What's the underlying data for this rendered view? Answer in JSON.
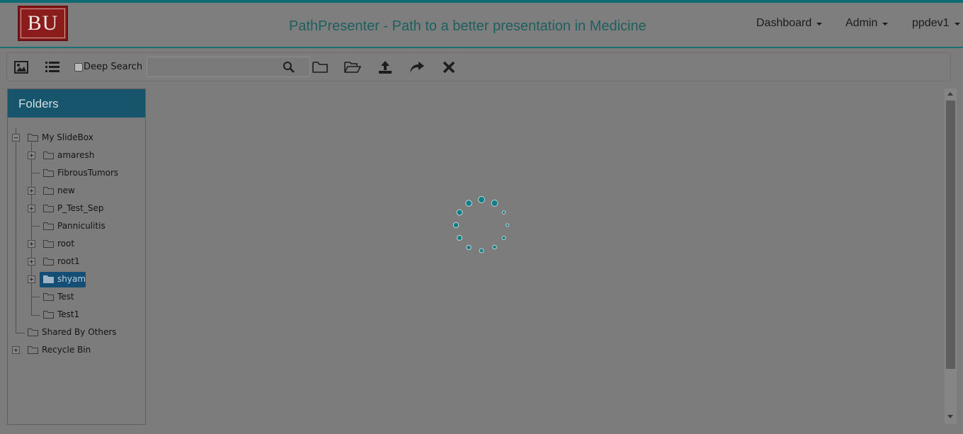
{
  "header": {
    "logo_text": "BU",
    "title": "PathPresenter - Path to a better presentation in Medicine",
    "menus": [
      {
        "label": "Dashboard"
      },
      {
        "label": "Admin"
      },
      {
        "label": "ppdev1"
      }
    ]
  },
  "toolbar": {
    "icons": [
      "image-view-icon",
      "list-view-icon",
      "search-icon",
      "new-folder-icon",
      "open-folder-icon",
      "upload-icon",
      "share-icon",
      "delete-icon"
    ],
    "deep_search_label": "Deep Search",
    "deep_search_checked": false,
    "search_value": "",
    "search_placeholder": ""
  },
  "folders_panel": {
    "title": "Folders",
    "tree": [
      {
        "label": "My SlideBox",
        "expanded": true
      },
      {
        "label": "amaresh",
        "expandable": true
      },
      {
        "label": "FibrousTumors",
        "expandable": false
      },
      {
        "label": "new",
        "expandable": true
      },
      {
        "label": "P_Test_Sep",
        "expandable": true
      },
      {
        "label": "Panniculitis",
        "expandable": false
      },
      {
        "label": "root",
        "expandable": true
      },
      {
        "label": "root1",
        "expandable": true
      },
      {
        "label": "shyam",
        "expandable": true,
        "selected": true
      },
      {
        "label": "Test",
        "expandable": false
      },
      {
        "label": "Test1",
        "expandable": false
      },
      {
        "label": "Shared By Others",
        "expandable": false
      },
      {
        "label": "Recycle Bin",
        "expandable": true
      }
    ]
  },
  "status": {
    "loading": true
  },
  "colors": {
    "accent": "#0f6b74",
    "title_text": "#1e5f5f",
    "panel_header": "#16556c",
    "selected_node": "#154e75",
    "spinner": "#0f7e86",
    "overlay_bg": "#7c7c7c"
  }
}
